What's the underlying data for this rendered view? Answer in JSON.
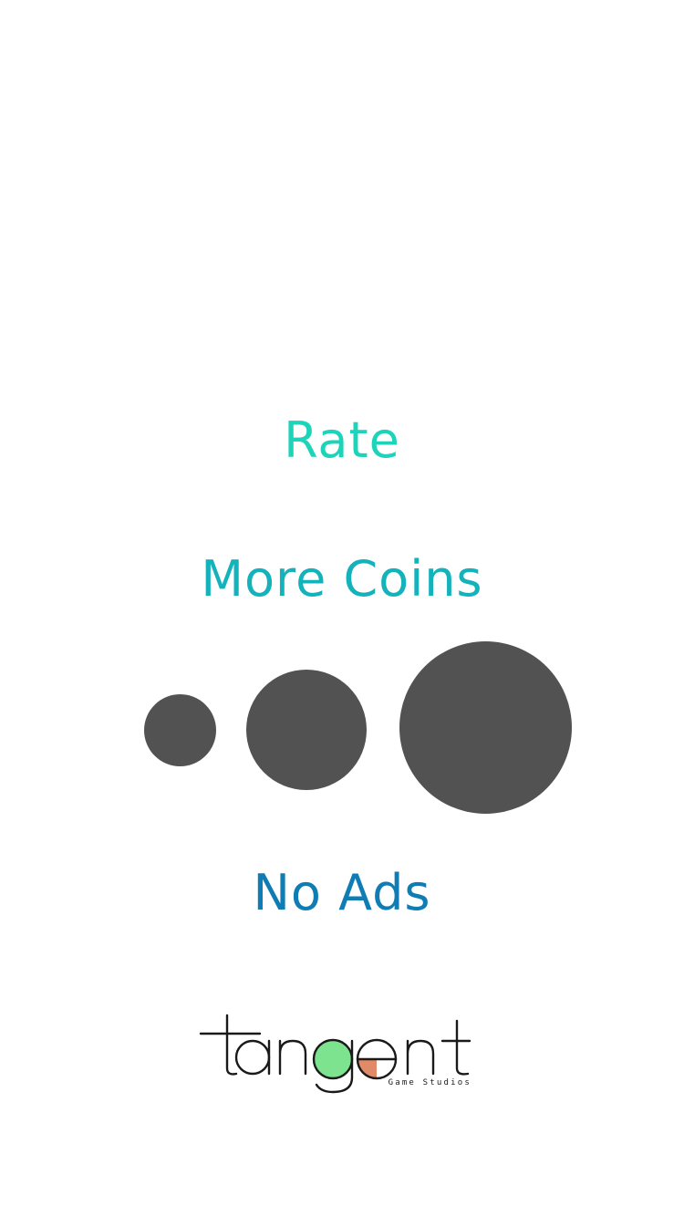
{
  "menu": {
    "rate_label": "Rate",
    "more_coins_label": "More Coins",
    "no_ads_label": "No Ads"
  },
  "colors": {
    "rate": "#1dd3b9",
    "more_coins": "#14b3bc",
    "no_ads": "#0f7cb4",
    "dot": "#525252",
    "logo_green": "#7de38e",
    "logo_orange": "#e08a68",
    "logo_ink": "#1a1a1a"
  },
  "logo": {
    "wordmark": "tangent",
    "tagline": "Game Studios"
  }
}
